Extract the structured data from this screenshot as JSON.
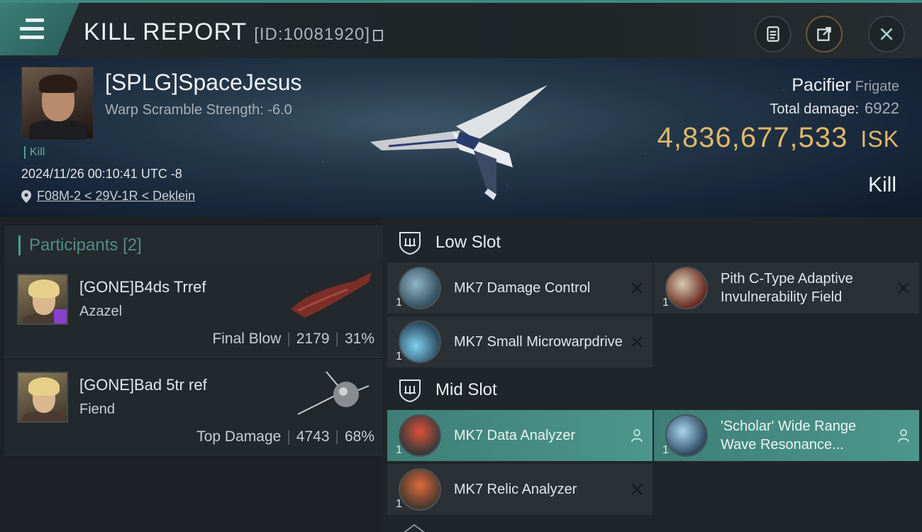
{
  "header": {
    "title": "KILL REPORT",
    "report_id": "[ID:10081920]"
  },
  "victim": {
    "name": "[SPLG]SpaceJesus",
    "warp_scramble": "Warp Scramble Strength: -6.0",
    "kill_tag": "Kill",
    "datetime": "2024/11/26 00:10:41 UTC -8",
    "location": "F08M-2 < 29V-1R < Deklein"
  },
  "ship": {
    "name": "Pacifier",
    "class": "Frigate",
    "total_damage_label": "Total damage:",
    "total_damage": "6922",
    "isk_value": "4,836,677,533",
    "isk_unit": "ISK",
    "result": "Kill"
  },
  "participants": {
    "label": "Participants",
    "count": "[2]",
    "rows": [
      {
        "name": "[GONE]B4ds Trref",
        "ship": "Azazel",
        "role": "Final Blow",
        "damage": "2179",
        "percent": "31%"
      },
      {
        "name": "[GONE]Bad 5tr ref",
        "ship": "Fiend",
        "role": "Top Damage",
        "damage": "4743",
        "percent": "68%"
      }
    ]
  },
  "fitting": {
    "low_slot_label": "Low Slot",
    "mid_slot_label": "Mid Slot",
    "low": [
      {
        "name": "MK7 Damage Control",
        "qty": "1",
        "icon": "damage-control-icon",
        "action": "close-icon"
      },
      {
        "name": "Pith C-Type Adaptive Invulnerability Field",
        "qty": "1",
        "icon": "invulnerability-field-icon",
        "action": "close-icon"
      },
      {
        "name": "MK7 Small Microwarpdrive",
        "qty": "1",
        "icon": "microwarpdrive-icon",
        "action": "close-icon"
      }
    ],
    "mid": [
      {
        "name": "MK7 Data Analyzer",
        "qty": "1",
        "icon": "data-analyzer-icon",
        "action": "person-icon"
      },
      {
        "name": "'Scholar' Wide Range Wave Resonance...",
        "qty": "1",
        "icon": "scanner-icon",
        "action": "person-icon"
      },
      {
        "name": "MK7 Relic Analyzer",
        "qty": "1",
        "icon": "relic-analyzer-icon",
        "action": "close-icon"
      }
    ]
  },
  "colors": {
    "accent": "#4aa190",
    "isk_gold": "#e1b868",
    "active_module": "#4d968c"
  }
}
